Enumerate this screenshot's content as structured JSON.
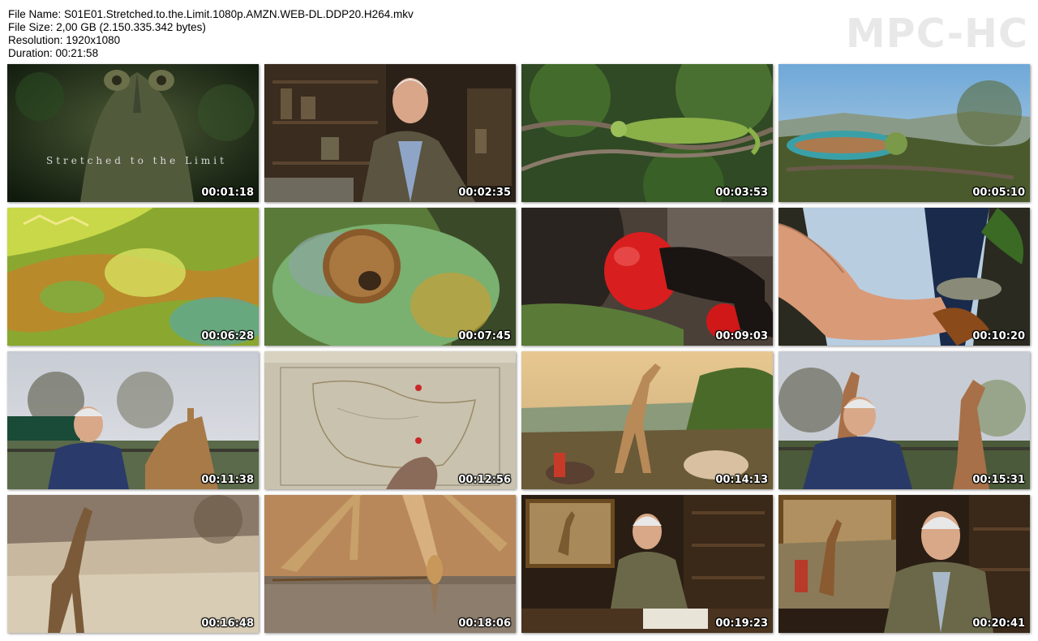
{
  "file_info": {
    "file_name": "File Name: S01E01.Stretched.to.the.Limit.1080p.AMZN.WEB-DL.DDP20.H264.mkv",
    "file_size": "File Size: 2,00 GB (2.150.335.342 bytes)",
    "resolution": "Resolution: 1920x1080",
    "duration": "Duration: 00:21:58"
  },
  "logo": "MPC-HC",
  "thumbnails": [
    {
      "timestamp": "00:01:18",
      "scene": "chameleon-head-dark",
      "caption": "Stretched to the Limit"
    },
    {
      "timestamp": "00:02:35",
      "scene": "presenter-study"
    },
    {
      "timestamp": "00:03:53",
      "scene": "chameleon-branch-forest"
    },
    {
      "timestamp": "00:05:10",
      "scene": "chameleon-branch-landscape"
    },
    {
      "timestamp": "00:06:28",
      "scene": "chameleon-skin-closeup"
    },
    {
      "timestamp": "00:07:45",
      "scene": "chameleon-eye-closeup"
    },
    {
      "timestamp": "00:09:03",
      "scene": "frigatebird-red-pouch"
    },
    {
      "timestamp": "00:10:20",
      "scene": "hand-with-chameleon"
    },
    {
      "timestamp": "00:11:38",
      "scene": "presenter-giraffe-outdoor"
    },
    {
      "timestamp": "00:12:56",
      "scene": "old-map"
    },
    {
      "timestamp": "00:14:13",
      "scene": "giraffe-painting"
    },
    {
      "timestamp": "00:15:31",
      "scene": "presenter-two-giraffes"
    },
    {
      "timestamp": "00:16:48",
      "scene": "giraffe-sepia"
    },
    {
      "timestamp": "00:18:06",
      "scene": "giraffe-drinking"
    },
    {
      "timestamp": "00:19:23",
      "scene": "presenter-desk-painting"
    },
    {
      "timestamp": "00:20:41",
      "scene": "presenter-painting-closeup"
    }
  ]
}
